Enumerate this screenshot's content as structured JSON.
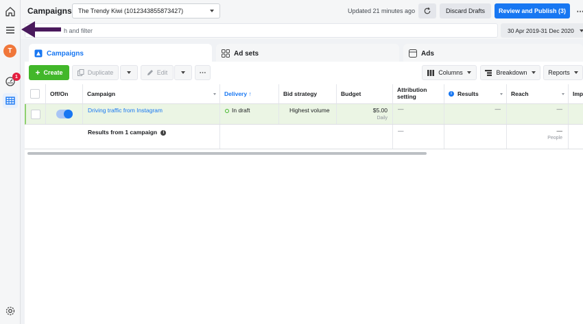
{
  "header": {
    "page_title": "Campaigns",
    "account": "The Trendy Kiwi (1012343855873427)",
    "updated": "Updated 21 minutes ago",
    "discard_label": "Discard Drafts",
    "publish_label": "Review and Publish (3)",
    "more_label": "⋯"
  },
  "rail": {
    "avatar_letter": "T",
    "notification_count": "1"
  },
  "search": {
    "placeholder": "h and filter",
    "date_range": "30 Apr 2019-31 Dec 2020"
  },
  "tabs": [
    {
      "label": "Campaigns",
      "active": true
    },
    {
      "label": "Ad sets",
      "active": false
    },
    {
      "label": "Ads",
      "active": false
    }
  ],
  "toolbar": {
    "create_label": "Create",
    "duplicate_label": "Duplicate",
    "edit_label": "Edit",
    "more_label": "⋯",
    "columns_label": "Columns",
    "breakdown_label": "Breakdown",
    "reports_label": "Reports"
  },
  "table": {
    "headers": {
      "offon": "Off/On",
      "campaign": "Campaign",
      "delivery": "Delivery ↑",
      "bid_strategy": "Bid strategy",
      "budget": "Budget",
      "attribution": "Attribution setting",
      "results": "Results",
      "reach": "Reach",
      "impressions": "Imp"
    },
    "row": {
      "campaign": "Driving traffic from Instagram",
      "delivery": "In draft",
      "bid_strategy": "Highest volume",
      "budget": "$5.00",
      "budget_period": "Daily",
      "attribution": "—",
      "results": "—",
      "reach": "—"
    },
    "summary": {
      "label": "Results from 1 campaign",
      "attribution": "—",
      "reach": "—",
      "reach_unit": "People"
    }
  },
  "colors": {
    "accent": "#1877f2",
    "create_green": "#42b72a",
    "draft_row": "#ebf5e4",
    "arrow": "#4a1a5c"
  }
}
